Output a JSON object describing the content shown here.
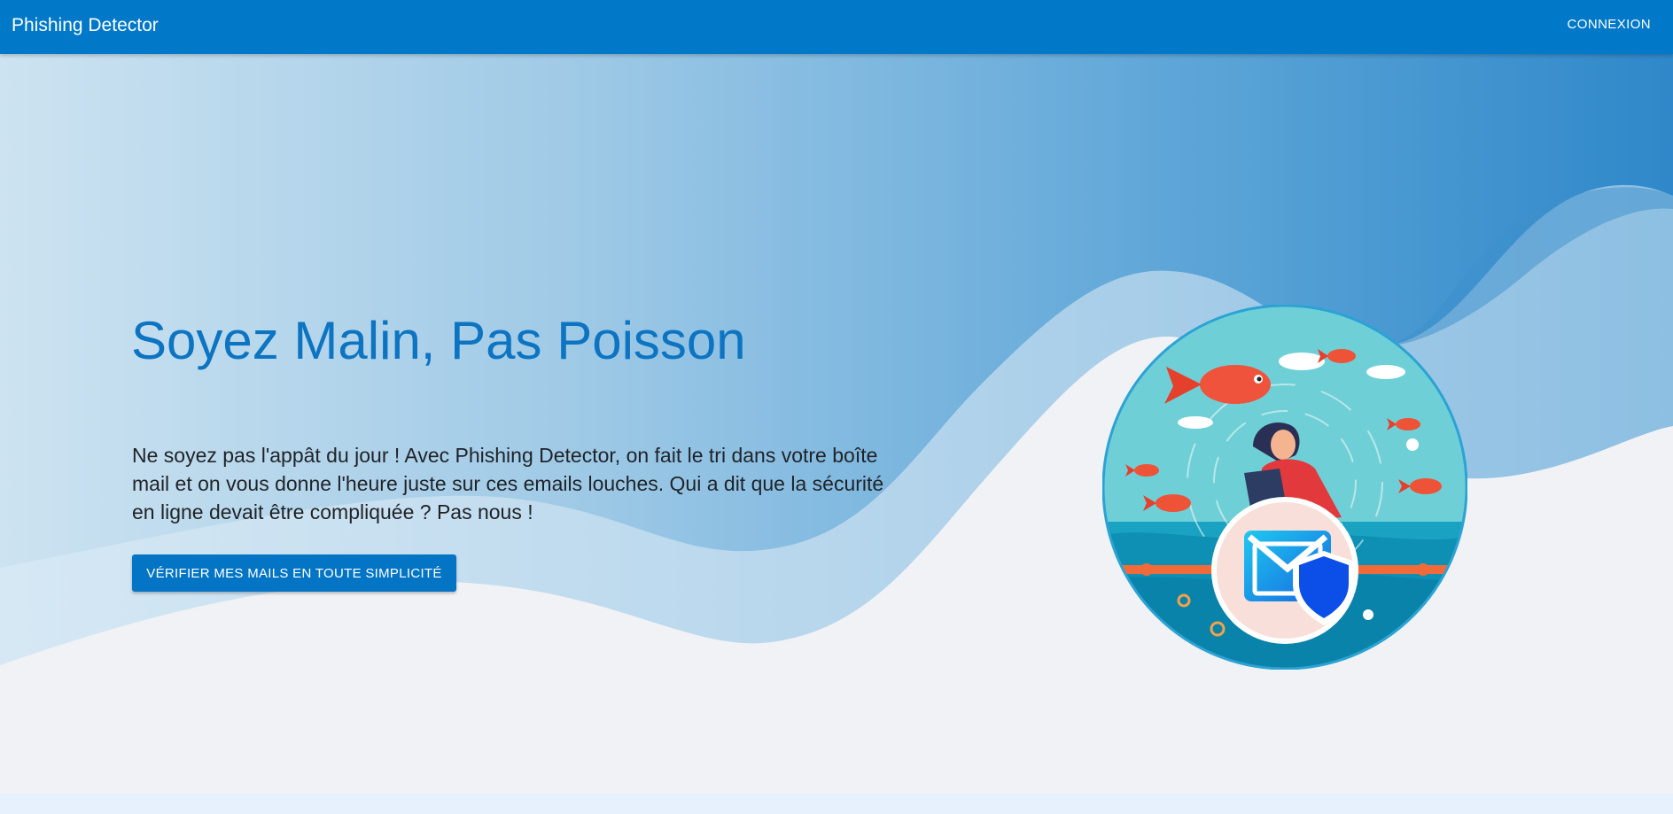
{
  "header": {
    "brand": "Phishing Detector",
    "login_label": "CONNEXION"
  },
  "hero": {
    "title": "Soyez Malin, Pas Poisson",
    "description": "Ne soyez pas l'appât du jour ! Avec Phishing Detector, on fait le tri dans votre boîte mail et on vous donne l'heure juste sur ces emails louches. Qui a dit que la sécurité en ligne devait être compliquée ? Pas nous !",
    "cta_label": "VÉRIFIER MES MAILS EN TOUTE SIMPLICITÉ",
    "illustration": "fisherman-email-shield-illustration"
  },
  "colors": {
    "primary": "#0178c8",
    "title": "#0d74c2",
    "background": "#f0f2f5",
    "footer_strip": "#e6f1fd"
  }
}
